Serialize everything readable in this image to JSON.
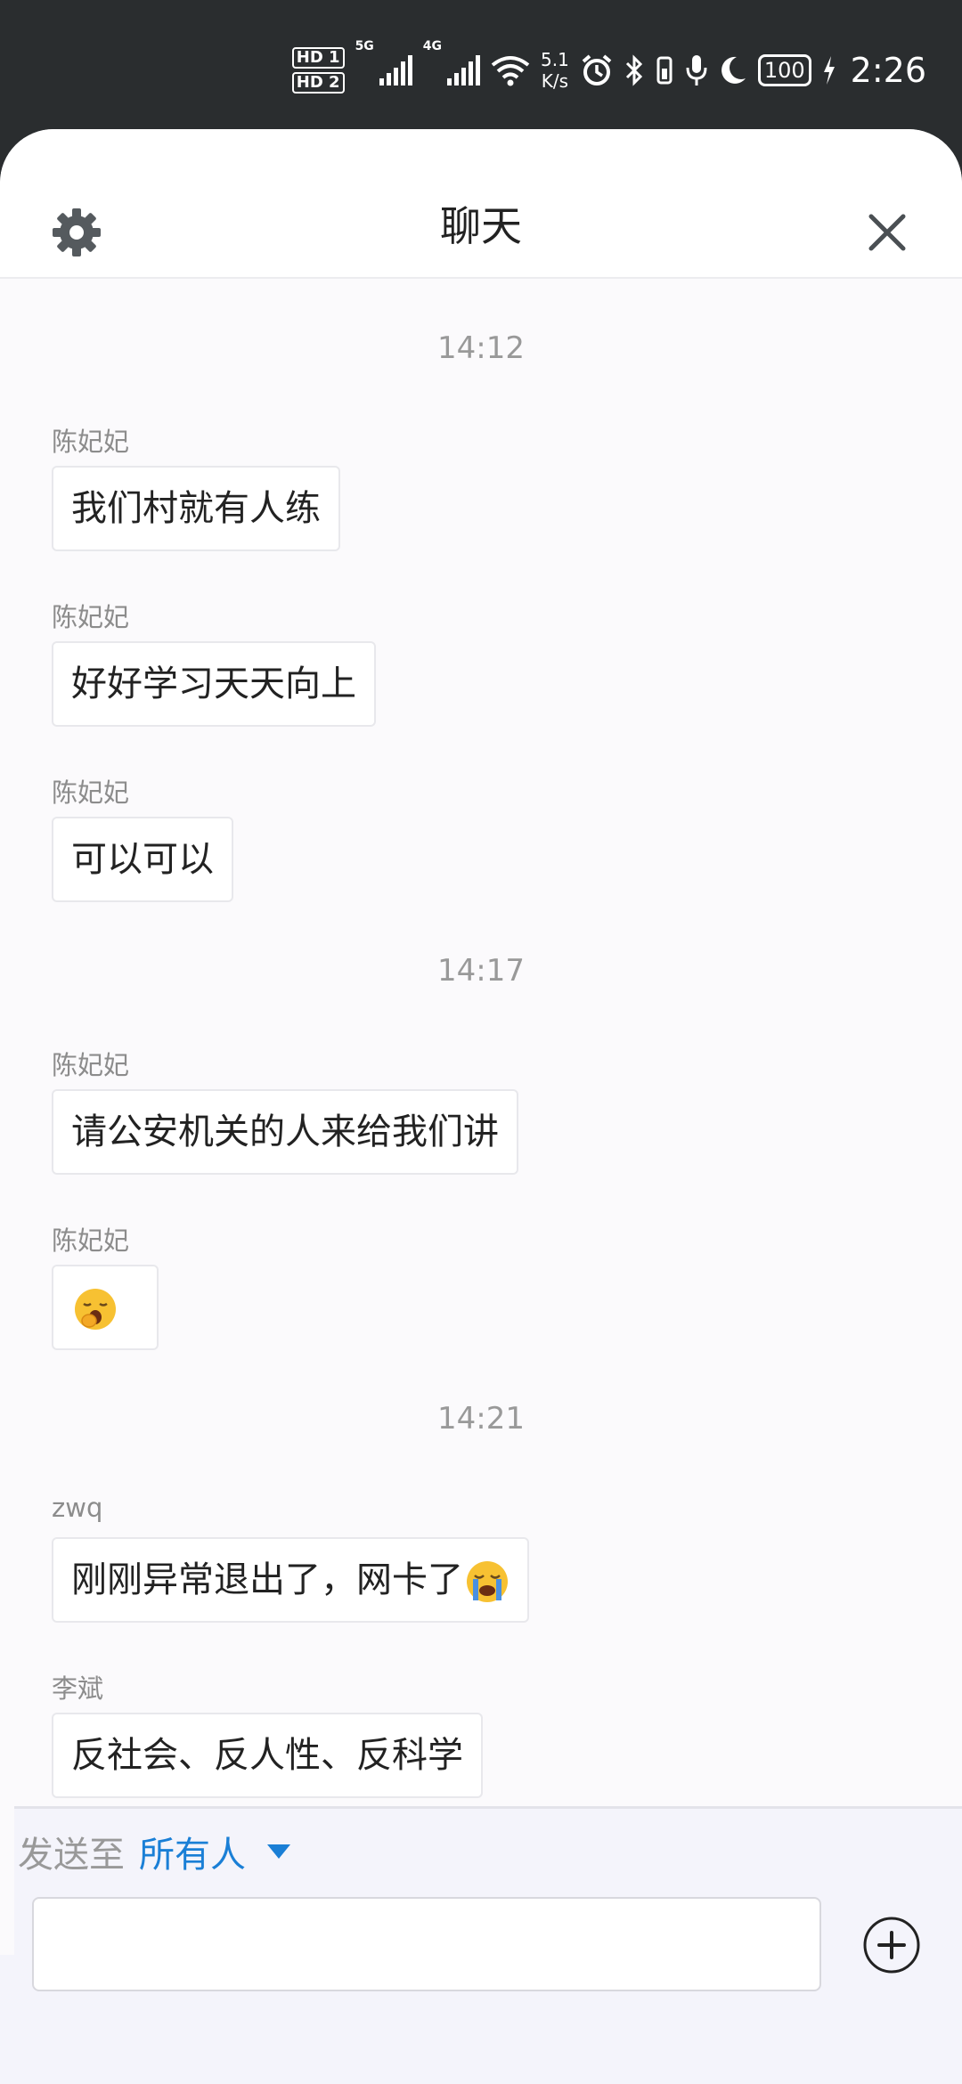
{
  "status_bar": {
    "sim1": "HD 1",
    "sim2": "HD 2",
    "net1": "5G",
    "net2": "4G",
    "speed_value": "5.1",
    "speed_unit": "K/s",
    "battery": "100",
    "time": "2:26",
    "icons": [
      "alarm-icon",
      "bluetooth-icon",
      "vibrate-icon",
      "microphone-icon",
      "moon-icon",
      "charging-icon"
    ]
  },
  "header": {
    "title": "聊天",
    "settings_icon": "gear-icon",
    "close_icon": "close-icon"
  },
  "messages": [
    {
      "type": "time",
      "text": "14:12"
    },
    {
      "type": "msg",
      "sender": "陈妃妃",
      "text": "我们村就有人练"
    },
    {
      "type": "msg",
      "sender": "陈妃妃",
      "text": "好好学习天天向上"
    },
    {
      "type": "msg",
      "sender": "陈妃妃",
      "text": "可以可以"
    },
    {
      "type": "time",
      "text": "14:17"
    },
    {
      "type": "msg",
      "sender": "陈妃妃",
      "text": "请公安机关的人来给我们讲"
    },
    {
      "type": "msg",
      "sender": "陈妃妃",
      "text": "",
      "emoji": "yawning-face"
    },
    {
      "type": "time",
      "text": "14:21"
    },
    {
      "type": "msg",
      "sender": "zwq",
      "text": "刚刚异常退出了，网卡了",
      "emoji": "crying-face"
    },
    {
      "type": "msg",
      "sender": "李斌",
      "text": "反社会、反人性、反科学"
    }
  ],
  "composer": {
    "send_to_label": "发送至",
    "send_to_target": "所有人",
    "input_value": "",
    "plus_icon": "plus-circle-icon"
  },
  "colors": {
    "status_bar_bg": "#2a2d2f",
    "panel_bg": "#fbfafc",
    "accent_blue": "#1a7fd6",
    "muted_text": "#999999"
  }
}
